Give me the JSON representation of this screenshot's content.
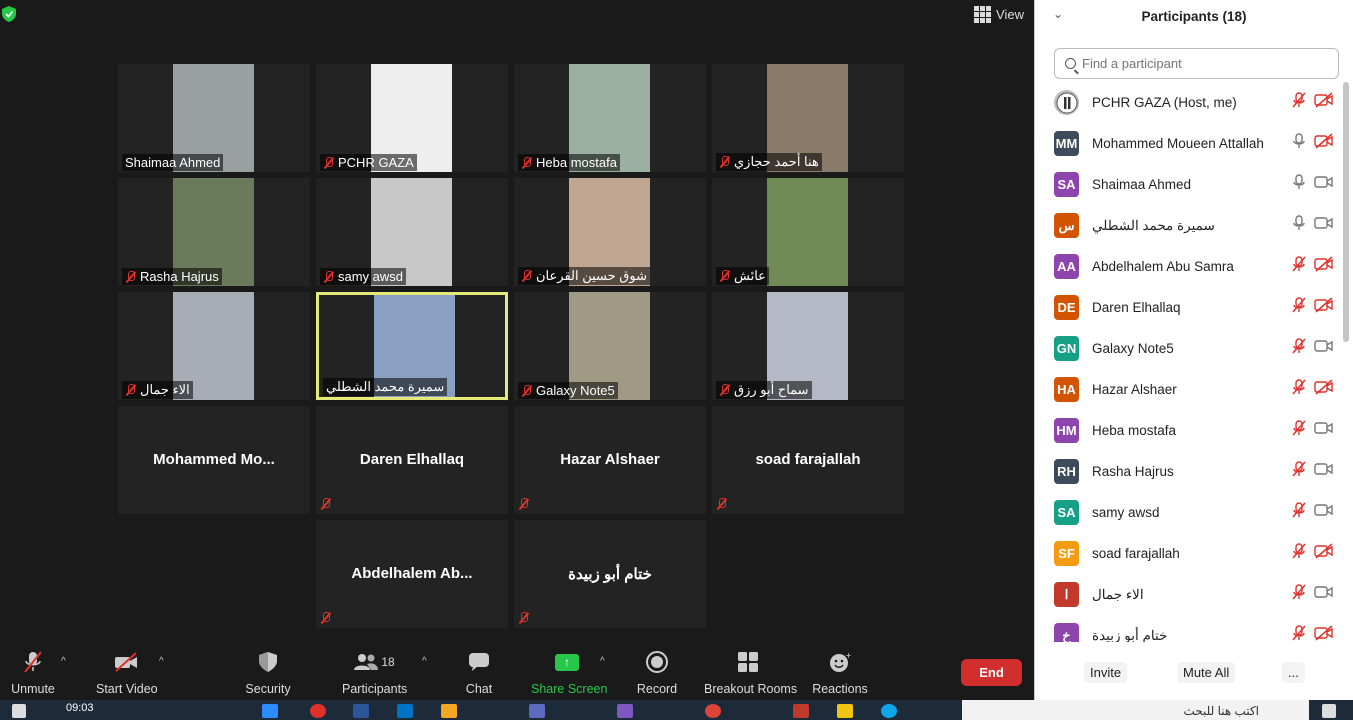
{
  "app": {
    "view_label": "View"
  },
  "colors": {
    "accent_green": "#27c84a",
    "end_red": "#d12e2e",
    "active_border": "#e5e97a",
    "muted_red": "#e0302a"
  },
  "tiles": [
    {
      "name": "Shaimaa Ahmed",
      "muted": false,
      "video": true,
      "color": "#9aa0a0"
    },
    {
      "name": "PCHR GAZA",
      "muted": true,
      "video": true,
      "color": "#eeeeee"
    },
    {
      "name": "Heba mostafa",
      "muted": true,
      "video": true,
      "color": "#9ab0a0"
    },
    {
      "name": "هنا أحمد حجازي",
      "muted": true,
      "video": true,
      "color": "#8a7a6a"
    },
    {
      "name": "Rasha Hajrus",
      "muted": true,
      "video": true,
      "color": "#6a7a5a"
    },
    {
      "name": "samy awsd",
      "muted": true,
      "video": true,
      "color": "#c8c8c8"
    },
    {
      "name": "شوق حسين القرعان",
      "muted": true,
      "video": true,
      "color": "#c0a590"
    },
    {
      "name": "عائش",
      "muted": true,
      "video": true,
      "color": "#6f8a55"
    },
    {
      "name": "الاء جمال",
      "muted": true,
      "video": true,
      "color": "#a8acb5"
    },
    {
      "name": "سميرة محمد الشطلي",
      "muted": false,
      "video": true,
      "color": "#8aa0c0",
      "active": true
    },
    {
      "name": "Galaxy Note5",
      "muted": true,
      "video": true,
      "color": "#a09a85"
    },
    {
      "name": "سماح أبو رزق",
      "muted": true,
      "video": true,
      "color": "#b5b8c5"
    },
    {
      "name": "Mohammed  Mo...",
      "muted": false,
      "video": false
    },
    {
      "name": "Daren Elhallaq",
      "muted": true,
      "video": false
    },
    {
      "name": "Hazar Alshaer",
      "muted": true,
      "video": false
    },
    {
      "name": "soad farajallah",
      "muted": true,
      "video": false
    },
    {
      "name": "Abdelhalem  Ab...",
      "muted": true,
      "video": false
    },
    {
      "name": "ختام أبو زبيدة",
      "muted": true,
      "video": false
    }
  ],
  "toolbar": {
    "unmute": "Unmute",
    "start_video": "Start Video",
    "security": "Security",
    "participants": "Participants",
    "participants_count": "18",
    "chat": "Chat",
    "share_screen": "Share Screen",
    "record": "Record",
    "breakout_rooms": "Breakout Rooms",
    "reactions": "Reactions",
    "end": "End"
  },
  "panel": {
    "title": "Participants (18)",
    "search_placeholder": "Find a participant",
    "invite": "Invite",
    "mute_all": "Mute All",
    "more": "...",
    "participants": [
      {
        "initials": "",
        "name": "PCHR GAZA (Host, me)",
        "color": "#bbbbbb",
        "mic": "off",
        "cam": "off"
      },
      {
        "initials": "MM",
        "name": "Mohammed Moueen Attallah",
        "color": "#3d4b5c",
        "mic": "on",
        "cam": "off"
      },
      {
        "initials": "SA",
        "name": "Shaimaa Ahmed",
        "color": "#8e44ad",
        "mic": "on",
        "cam": "on"
      },
      {
        "initials": "س",
        "name": "سميرة محمد الشطلي",
        "color": "#d35400",
        "mic": "on",
        "cam": "on"
      },
      {
        "initials": "AA",
        "name": "Abdelhalem Abu Samra",
        "color": "#8e44ad",
        "mic": "off",
        "cam": "off"
      },
      {
        "initials": "DE",
        "name": "Daren Elhallaq",
        "color": "#d35400",
        "mic": "off",
        "cam": "off"
      },
      {
        "initials": "GN",
        "name": "Galaxy Note5",
        "color": "#16a085",
        "mic": "off",
        "cam": "on"
      },
      {
        "initials": "HA",
        "name": "Hazar Alshaer",
        "color": "#d35400",
        "mic": "off",
        "cam": "off"
      },
      {
        "initials": "HM",
        "name": "Heba mostafa",
        "color": "#8e44ad",
        "mic": "off",
        "cam": "on"
      },
      {
        "initials": "RH",
        "name": "Rasha Hajrus",
        "color": "#3d4b5c",
        "mic": "off",
        "cam": "on"
      },
      {
        "initials": "SA",
        "name": "samy awsd",
        "color": "#16a085",
        "mic": "off",
        "cam": "on"
      },
      {
        "initials": "SF",
        "name": "soad farajallah",
        "color": "#f39c12",
        "mic": "off",
        "cam": "off"
      },
      {
        "initials": "ا",
        "name": "الاء جمال",
        "color": "#c0392b",
        "mic": "off",
        "cam": "on"
      },
      {
        "initials": "خ",
        "name": "ختام أبو زبيدة",
        "color": "#8e44ad",
        "mic": "off",
        "cam": "off"
      }
    ]
  },
  "taskbar": {
    "time": "09:03",
    "search_text": "اكتب هنا للبحث"
  }
}
